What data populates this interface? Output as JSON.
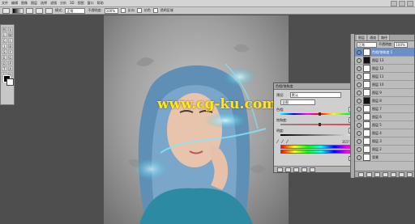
{
  "menubar": {
    "items": [
      "文件",
      "编辑",
      "图像",
      "图层",
      "选择",
      "滤镜",
      "分析",
      "3D",
      "视图",
      "窗口",
      "帮助"
    ]
  },
  "options_bar": {
    "mode_label": "模式:",
    "mode_value": "正常",
    "opacity_label": "不透明度:",
    "opacity_value": "100%",
    "reverse_label": "反向",
    "dither_label": "仿色",
    "transparency_label": "透明区域"
  },
  "tools": [
    "M",
    "V",
    "L",
    "W",
    "C",
    "I",
    "J",
    "B",
    "S",
    "Y",
    "E",
    "G",
    "O",
    "P",
    "T",
    "A",
    "U",
    "H",
    "Z",
    "R"
  ],
  "canvas": {
    "watermark_text": "www.cg-ku.com"
  },
  "adjust_dialog": {
    "title": "色相/饱和度",
    "preset_label": "预设:",
    "preset_value": "默认",
    "channel_value": "全图",
    "hue_label": "色相:",
    "hue_value": "0",
    "saturation_label": "饱和度:",
    "saturation_value": "0",
    "lightness_label": "明度:",
    "lightness_value": "0",
    "colorize_label": "着色",
    "range_readout": "315°/345°"
  },
  "layers_panel": {
    "tabs": [
      "图层",
      "通道",
      "路径"
    ],
    "blend_value": "正常",
    "opacity_label": "不透明度:",
    "opacity_value": "100%",
    "rows": [
      {
        "name": "色相/饱和度 1",
        "selected": true,
        "dark": false
      },
      {
        "name": "图层 13",
        "selected": false,
        "dark": true
      },
      {
        "name": "图层 12",
        "selected": false,
        "dark": false
      },
      {
        "name": "图层 11",
        "selected": false,
        "dark": false
      },
      {
        "name": "图层 10",
        "selected": false,
        "dark": false
      },
      {
        "name": "图层 9",
        "selected": false,
        "dark": false
      },
      {
        "name": "图层 8",
        "selected": false,
        "dark": true
      },
      {
        "name": "图层 7",
        "selected": false,
        "dark": false
      },
      {
        "name": "图层 6",
        "selected": false,
        "dark": false
      },
      {
        "name": "图层 5",
        "selected": false,
        "dark": false
      },
      {
        "name": "图层 4",
        "selected": false,
        "dark": false
      },
      {
        "name": "图层 3",
        "selected": false,
        "dark": false
      },
      {
        "name": "图层 2",
        "selected": false,
        "dark": false
      },
      {
        "name": "背景",
        "selected": false,
        "dark": false
      }
    ]
  }
}
